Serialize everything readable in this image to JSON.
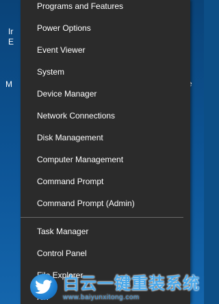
{
  "desktop": {
    "fragments": [
      "Ir",
      "E",
      "M",
      "e"
    ]
  },
  "menu": {
    "items": [
      {
        "label": "Programs and Features"
      },
      {
        "label": "Power Options"
      },
      {
        "label": "Event Viewer"
      },
      {
        "label": "System"
      },
      {
        "label": "Device Manager"
      },
      {
        "label": "Network Connections"
      },
      {
        "label": "Disk Management"
      },
      {
        "label": "Computer Management"
      },
      {
        "label": "Command Prompt"
      },
      {
        "label": "Command Prompt (Admin)"
      },
      {
        "label": "Task Manager"
      },
      {
        "label": "Control Panel"
      },
      {
        "label": "File Explorer"
      },
      {
        "label": "rch"
      }
    ]
  },
  "watermark": {
    "title": "白云一键重装系统",
    "url": "www.baiyunxitong.com",
    "icon": "twitter-bird-icon"
  },
  "colors": {
    "menu_background": "#2b2b2b",
    "menu_text": "#ffffff",
    "separator": "#6a6a6a",
    "desktop": "#0c4e86",
    "watermark": "#4aa8ea"
  }
}
